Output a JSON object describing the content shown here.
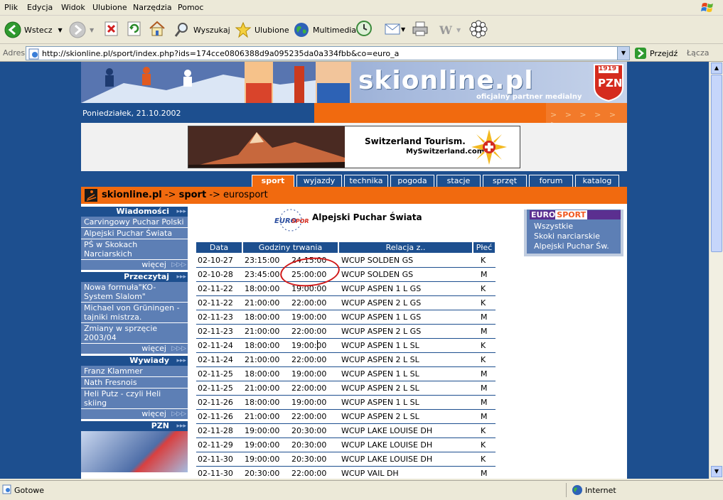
{
  "menu": [
    "Plik",
    "Edycja",
    "Widok",
    "Ulubione",
    "Narzędzia",
    "Pomoc"
  ],
  "toolbar": {
    "back": "Wstecz",
    "search": "Wyszukaj",
    "favorites": "Ulubione",
    "multimedia": "Multimedia"
  },
  "address": {
    "label": "Adres",
    "url": "http://skionline.pl/sport/index.php?ids=174cce0806388d9a095235da0a334fbb&co=euro_a",
    "go": "Przejdź",
    "links": "Łącza"
  },
  "banner": {
    "logo": "skionline.pl",
    "tagline": "oficjalny partner medialny",
    "badge_year": "1919",
    "badge_text": "PZN"
  },
  "date_text": "Poniedziałek, 21.10.2002",
  "date_arrows": "> > >  > > >",
  "ad": {
    "line1": "Switzerland Tourism.",
    "line2": "MySwitzerland.com"
  },
  "tabs": [
    "sport",
    "wyjazdy",
    "technika",
    "pogoda",
    "stacje",
    "sprzęt",
    "forum",
    "katalog"
  ],
  "breadcrumb": {
    "home": "skionline.pl",
    "sep": " -> ",
    "section": "sport",
    "page": "eurosport"
  },
  "sidebar": {
    "wiadomosci": {
      "title": "Wiadomości",
      "items": [
        "Carvingowy Puchar Polski",
        "Alpejski Puchar Świata",
        "PŚ w Skokach Narciarskich"
      ],
      "more": "więcej"
    },
    "przeczytaj": {
      "title": "Przeczytaj",
      "items": [
        "Nowa formuła\"KO-System Slalom\"",
        "Michael von Grüningen - tajniki mistrza.",
        "Zmiany w sprzęcie 2003/04"
      ],
      "more": "więcej"
    },
    "wywiady": {
      "title": "Wywiady",
      "items": [
        "Franz Klammer",
        "Nath Fresnois",
        "Heli Putz - czyli Heli skiing"
      ],
      "more": "więcej"
    },
    "pzn": {
      "title": "PZN"
    }
  },
  "main_title": "Alpejski Puchar Świata",
  "eurosport_logo": "EUROSPORT",
  "table": {
    "headers": [
      "Data",
      "Godziny trwania",
      "Relacja z..",
      "Płeć"
    ],
    "rows": [
      [
        "02-10-27",
        "23:15:00",
        "24:15:00",
        "WCUP SOLDEN GS",
        "K"
      ],
      [
        "02-10-28",
        "23:45:00",
        "25:00:00",
        "WCUP SOLDEN GS",
        "M"
      ],
      [
        "02-11-22",
        "18:00:00",
        "19:00:00",
        "WCUP ASPEN 1 L GS",
        "K"
      ],
      [
        "02-11-22",
        "21:00:00",
        "22:00:00",
        "WCUP ASPEN 2 L GS",
        "K"
      ],
      [
        "02-11-23",
        "18:00:00",
        "19:00:00",
        "WCUP ASPEN 1 L GS",
        "M"
      ],
      [
        "02-11-23",
        "21:00:00",
        "22:00:00",
        "WCUP ASPEN 2 L GS",
        "M"
      ],
      [
        "02-11-24",
        "18:00:00",
        "19:00:00",
        "WCUP ASPEN 1 L SL",
        "K"
      ],
      [
        "02-11-24",
        "21:00:00",
        "22:00:00",
        "WCUP ASPEN 2 L SL",
        "K"
      ],
      [
        "02-11-25",
        "18:00:00",
        "19:00:00",
        "WCUP ASPEN 1 L SL",
        "M"
      ],
      [
        "02-11-25",
        "21:00:00",
        "22:00:00",
        "WCUP ASPEN 2 L SL",
        "M"
      ],
      [
        "02-11-26",
        "18:00:00",
        "19:00:00",
        "WCUP ASPEN 1 L SL",
        "M"
      ],
      [
        "02-11-26",
        "21:00:00",
        "22:00:00",
        "WCUP ASPEN 2 L SL",
        "M"
      ],
      [
        "02-11-28",
        "19:00:00",
        "20:30:00",
        "WCUP LAKE LOUISE DH",
        "K"
      ],
      [
        "02-11-29",
        "19:00:00",
        "20:30:00",
        "WCUP LAKE LOUISE DH",
        "K"
      ],
      [
        "02-11-30",
        "19:00:00",
        "20:30:00",
        "WCUP LAKE LOUISE DH",
        "K"
      ],
      [
        "02-11-30",
        "20:30:00",
        "22:00:00",
        "WCUP VAIL DH",
        "M"
      ]
    ]
  },
  "eurobox": {
    "euro": "EURO",
    "sport": "SPORT",
    "items": [
      "Wszystkie",
      "Skoki narciarskie",
      "Alpejski Puchar Św."
    ]
  },
  "status": {
    "left": "Gotowe",
    "zone": "Internet"
  },
  "colors": {
    "navy": "#1d4f8f",
    "orange": "#f16a0f",
    "side": "#5d7fb5",
    "purple": "#5b2f90",
    "ring": "#d01818"
  }
}
